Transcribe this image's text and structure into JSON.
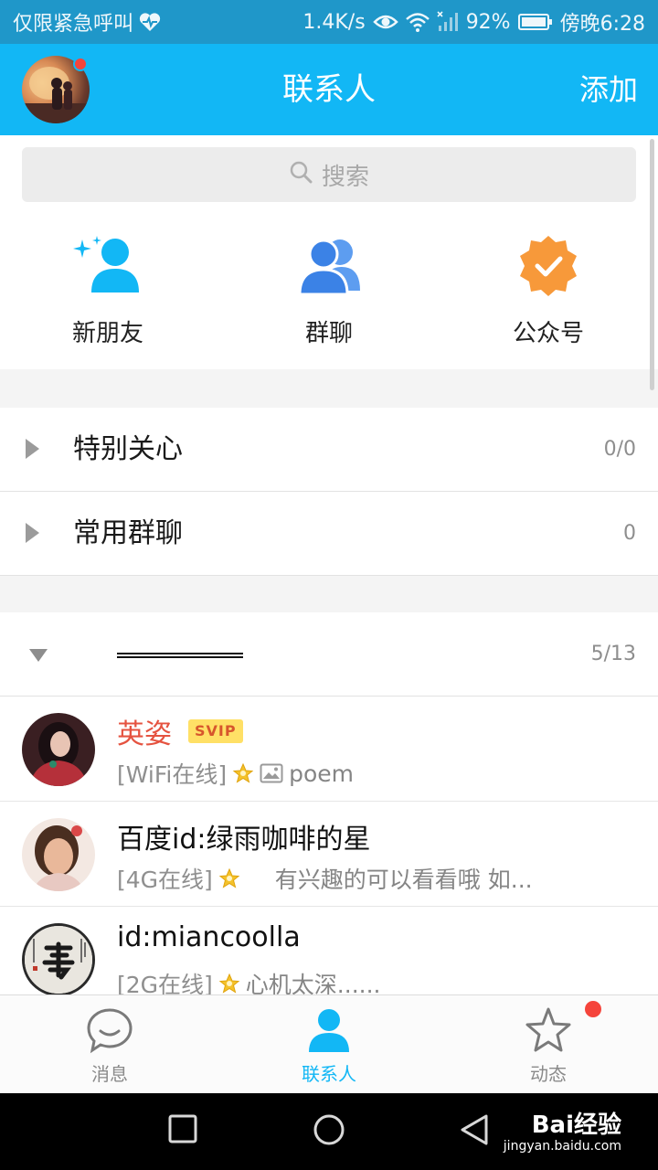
{
  "status_bar": {
    "carrier_text": "仅限紧急呼叫",
    "speed": "1.4K/s",
    "battery": "92%",
    "time": "傍晚6:28"
  },
  "header": {
    "title": "联系人",
    "add_label": "添加"
  },
  "search": {
    "placeholder": "搜索"
  },
  "quick_actions": [
    {
      "label": "新朋友",
      "icon": "new-friend-icon"
    },
    {
      "label": "群聊",
      "icon": "group-chat-icon"
    },
    {
      "label": "公众号",
      "icon": "official-account-icon"
    }
  ],
  "groups": [
    {
      "name": "特别关心",
      "count": "0/0",
      "expanded": false
    },
    {
      "name": "常用群聊",
      "count": "0",
      "expanded": false
    },
    {
      "name": "",
      "count": "5/13",
      "expanded": true
    }
  ],
  "contacts": [
    {
      "name": "英姿",
      "badge": "SVIP",
      "status": "[WiFi在线]",
      "message": "poem",
      "name_color": "#e55340"
    },
    {
      "name": "百度id:绿雨咖啡的星",
      "status": "[4G在线]",
      "message": "有兴趣的可以看看哦  如..."
    },
    {
      "name": "id:miancoolla",
      "status": "[2G在线]",
      "message": "心机太深......"
    }
  ],
  "tabs": [
    {
      "label": "消息",
      "icon": "message-icon",
      "active": false
    },
    {
      "label": "联系人",
      "icon": "contacts-icon",
      "active": true
    },
    {
      "label": "动态",
      "icon": "star-icon",
      "active": false,
      "has_dot": true
    }
  ],
  "watermark": {
    "brand": "Bai经验",
    "url": "jingyan.baidu.com"
  },
  "colors": {
    "accent": "#12b7f5",
    "status_bar": "#1f97c9",
    "unread_dot": "#f5443b",
    "official_account": "#f7993a"
  }
}
